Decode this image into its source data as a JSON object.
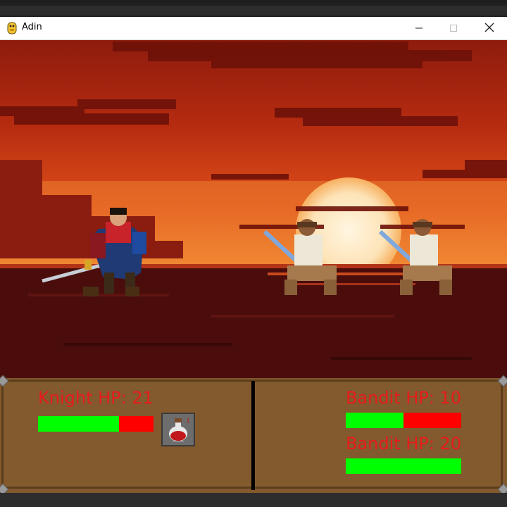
{
  "window": {
    "title": "Adin",
    "icons": {
      "app": "python-snake-icon",
      "minimize": "minimize-icon",
      "maximize": "maximize-icon",
      "close": "close-icon"
    }
  },
  "scene": {
    "description_icons": [
      "knight-sprite",
      "bandit-sprite",
      "bandit-sprite"
    ],
    "sky_colors": [
      "#a52410",
      "#e04a12",
      "#f7a23c",
      "#fde9c8"
    ],
    "sea_color": "#4a0d0c"
  },
  "hud": {
    "colors": {
      "panel": "#835a2e",
      "label": "#e81b1b",
      "hp_good": "#00ff00",
      "hp_bad": "#ff0000"
    },
    "player": {
      "label": "Knight HP: 21",
      "hp_fraction": 0.7
    },
    "inventory": {
      "item_icon": "health-potion-icon",
      "count_label": "1"
    },
    "enemies": [
      {
        "label": "Bandit HP: 10",
        "hp_fraction": 0.5
      },
      {
        "label": "Bandit HP: 20",
        "hp_fraction": 1.0
      }
    ]
  }
}
